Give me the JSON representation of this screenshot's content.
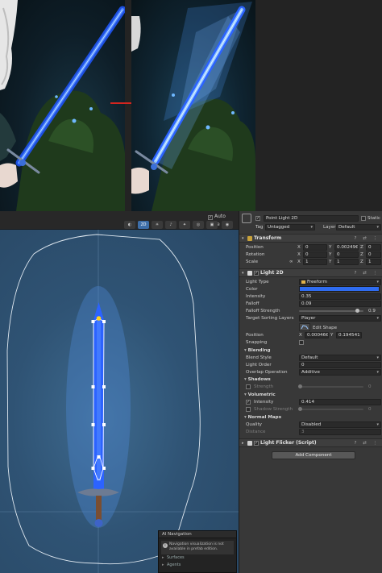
{
  "scene_toolbar": {
    "auto_save_label": "Auto Save",
    "auto_save_checked": true,
    "mode_2d_label": "2D"
  },
  "ai_navigation": {
    "title": "AI Navigation",
    "message": "Navigation visualization is not available in prefab edition.",
    "rows": [
      "Surfaces",
      "Agents"
    ]
  },
  "inspector": {
    "object_name": "Point Light 2D",
    "static_label": "Static",
    "tag_label": "Tag",
    "tag_value": "Untagged",
    "layer_label": "Layer",
    "layer_value": "Default",
    "transform": {
      "title": "Transform",
      "position_label": "Position",
      "position": {
        "x": "0",
        "y": "0.00249€",
        "z": "0"
      },
      "rotation_label": "Rotation",
      "rotation": {
        "x": "0",
        "y": "0",
        "z": "0"
      },
      "scale_label": "Scale",
      "scale": {
        "x": "1",
        "y": "1",
        "z": "1"
      }
    },
    "light2d": {
      "title": "Light 2D",
      "light_type_label": "Light Type",
      "light_type_value": "Freeform",
      "color_label": "Color",
      "color_hex": "#2f6cf0",
      "intensity_label": "Intensity",
      "intensity_value": "0.35",
      "falloff_label": "Falloff",
      "falloff_value": "0.09",
      "falloff_strength_label": "Falloff Strength",
      "falloff_strength_value": "0.9",
      "falloff_strength_fraction": 0.9,
      "target_sorting_label": "Target Sorting Layers",
      "target_sorting_value": "Player",
      "edit_shape_label": "Edit Shape",
      "position_label": "Position",
      "position": {
        "x": "0.00046€",
        "y": "0.194541"
      },
      "snapping_label": "Snapping"
    },
    "blending": {
      "title": "Blending",
      "blend_style_label": "Blend Style",
      "blend_style_value": "Default",
      "light_order_label": "Light Order",
      "light_order_value": "0",
      "overlap_label": "Overlap Operation",
      "overlap_value": "Additive"
    },
    "shadows": {
      "title": "Shadows",
      "strength_label": "Strength",
      "strength_value": "0",
      "enabled": false
    },
    "volumetric": {
      "title": "Volumetric",
      "intensity_label": "Intensity",
      "intensity_value": "0.414",
      "enabled": true,
      "shadow_strength_label": "Shadow Strength",
      "shadow_strength_value": "0",
      "shadow_enabled": false
    },
    "normal_maps": {
      "title": "Normal Maps",
      "quality_label": "Quality",
      "quality_value": "Disabled",
      "distance_label": "Distance",
      "distance_value": "3"
    },
    "light_flicker": {
      "title": "Light Flicker (Script)"
    },
    "add_component_label": "Add Component"
  },
  "colors": {
    "scene_bg": "#2f5374",
    "sword_blade": "#2c63ff",
    "accent": "#3d6ea8"
  }
}
